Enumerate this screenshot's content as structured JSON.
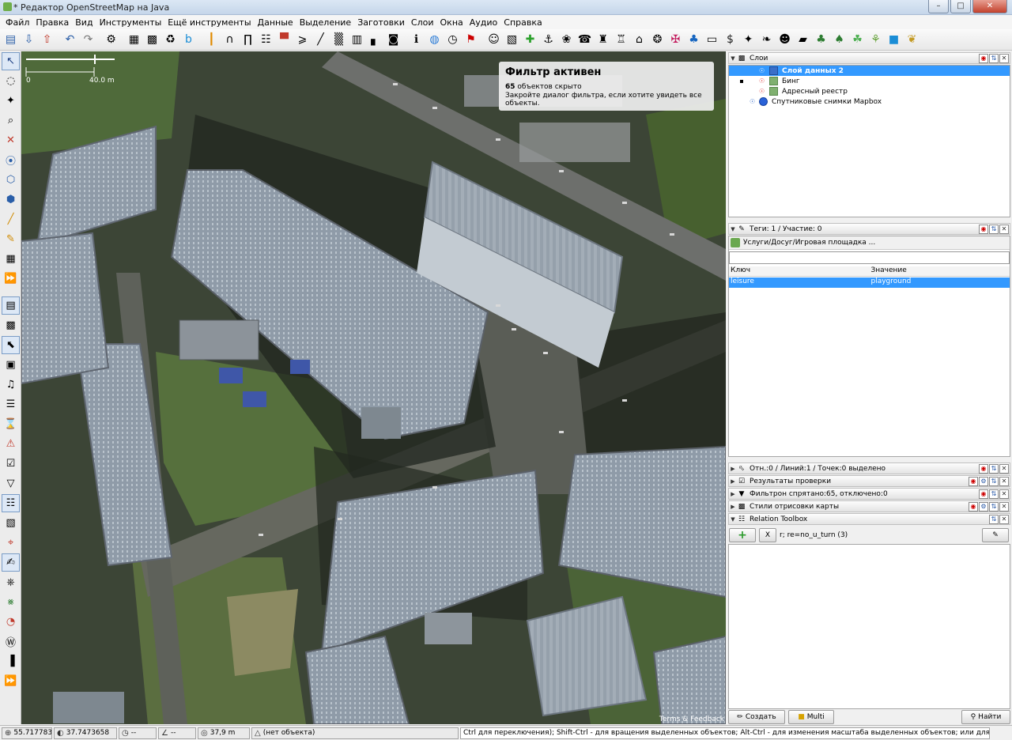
{
  "window": {
    "title": "* Редактор OpenStreetMap на Java"
  },
  "menu": [
    "Файл",
    "Правка",
    "Вид",
    "Инструменты",
    "Ещё инструменты",
    "Данные",
    "Выделение",
    "Заготовки",
    "Слои",
    "Окна",
    "Аудио",
    "Справка"
  ],
  "toolbar_icons": [
    "open-folder-icon",
    "download-icon",
    "upload-icon",
    "sep",
    "undo-icon",
    "redo-icon",
    "sep",
    "preferences-icon",
    "sep",
    "wms-icon",
    "imagery-icon",
    "refresh-icon",
    "bing-icon",
    "sep",
    "highway-icon",
    "tunnel-icon",
    "bridge-icon",
    "traffic-signals-icon",
    "barrier-icon",
    "railway-icon",
    "crossing-icon",
    "rail-icon",
    "area-icon",
    "building-icon",
    "car-icon",
    "sep",
    "info-icon",
    "globe-icon",
    "clock-icon",
    "flag-icon",
    "sep",
    "theater-icon",
    "picture-icon",
    "plus-green-icon",
    "boat-icon",
    "balloons-icon",
    "phone-icon",
    "castle-icon",
    "factory-icon",
    "house-icon",
    "fork-knife-icon",
    "cart-icon",
    "shirt-icon",
    "tv-icon",
    "dollar-icon",
    "shop-icon",
    "paperclip-icon",
    "person-icon",
    "bag-icon",
    "tree-icon",
    "forest-icon",
    "grass-icon",
    "meadow-icon",
    "water-icon",
    "crop-icon"
  ],
  "left_tools": [
    "select-tool-icon",
    "lasso-tool-icon",
    "draw-tool-icon",
    "zoom-tool-icon",
    "delete-tool-icon",
    "combine-way-icon",
    "split-way-icon",
    "join-node-icon",
    "draw-road-icon",
    "pencil-icon",
    "building-tool-icon",
    "play-icon",
    "sep",
    "layers-toggle-icon",
    "mapcss-icon",
    "select-toggle-icon",
    "changeset-icon",
    "audio-icon",
    "notes-icon",
    "history-icon",
    "warning-icon",
    "validation-icon",
    "filter-icon",
    "relation-icon",
    "map-paint-icon",
    "pin-icon",
    "edit-icon",
    "tag-icon",
    "graph-icon",
    "speedometer-icon",
    "wiki-icon",
    "barcode-icon",
    "play2-icon"
  ],
  "map": {
    "scale_label_start": "0",
    "scale_label_end": "40.0 m",
    "filter_title": "Фильтр активен",
    "filter_count": "65",
    "filter_count_label": "объектов скрыто",
    "filter_hint": "Закройте диалог фильтра, если хотите увидеть все объекты.",
    "terms": "Terms & Feedback"
  },
  "layers_panel": {
    "title": "Слои",
    "items": [
      {
        "name": "Слой данных 2",
        "selected": true
      },
      {
        "name": "Бинг",
        "selected": false
      },
      {
        "name": "Адресный реестр",
        "selected": false
      },
      {
        "name": "Спутниковые снимки Mapbox",
        "selected": false
      }
    ]
  },
  "tags_panel": {
    "title": "Теги: 1 / Участие: 0",
    "preset": "Услуги/Досуг/Игровая площадка ...",
    "col_key": "Ключ",
    "col_value": "Значение",
    "rows": [
      {
        "key": "leisure",
        "value": "playground"
      }
    ]
  },
  "collapsed_panels": [
    {
      "title": "Отн.:0 / Линий:1 / Точек:0 выделено"
    },
    {
      "title": "Результаты проверки"
    },
    {
      "title": "Фильтрон спрятано:65, отключено:0"
    },
    {
      "title": "Стили отрисовки карты"
    },
    {
      "title": "Relation Toolbox"
    }
  ],
  "relation_toolbox": {
    "add": "+",
    "remove": "X",
    "relation_text": "r; re=no_u_turn (3)"
  },
  "bottom_buttons": {
    "create": "Создать",
    "multi": "Multi",
    "search": "Найти"
  },
  "status": {
    "lat": "55.7177835",
    "lon": "37.7473658",
    "heading": "--",
    "angle": "--",
    "distance": "37,9 m",
    "object": "(нет объекта)",
    "hint": "Ctrl для переключения); Shift-Ctrl - для вращения выделенных объектов; Alt-Ctrl - для изменения масштаба выделенных объектов; или для изменения выделения"
  },
  "colors": {
    "selection": "#3399ff",
    "map_background": "#4f5a46",
    "close_button": "#c2402b"
  }
}
